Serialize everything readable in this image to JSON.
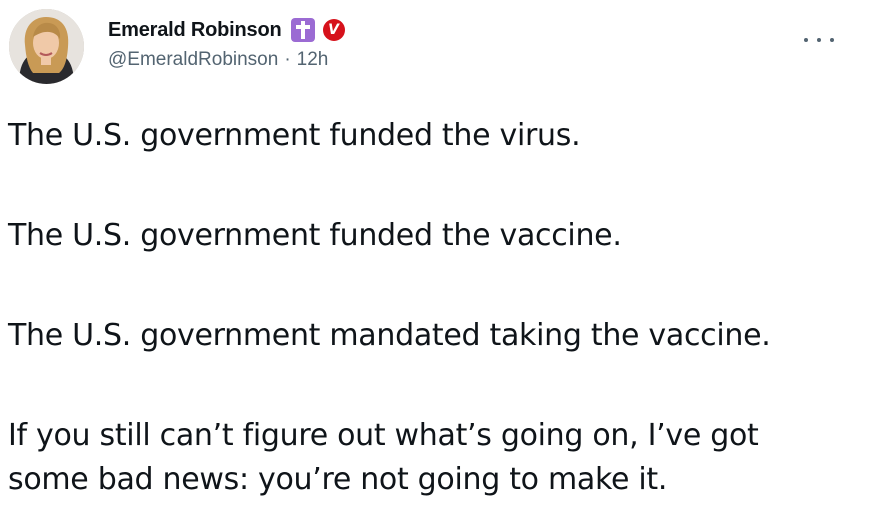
{
  "tweet": {
    "author": {
      "display_name": "Emerald Robinson",
      "handle": "@EmeraldRobinson",
      "badges": [
        "cross-badge",
        "verified-v-badge"
      ],
      "v_badge_letter": "V"
    },
    "time_separator": "·",
    "timestamp": "12h",
    "more_menu_icon": "ellipsis-icon",
    "paragraphs": [
      "The U.S. government funded the virus.",
      "The U.S. government funded the vaccine.",
      "The U.S. government mandated taking the vaccine.",
      "If you still can’t figure out what’s going on, I’ve got",
      "some bad news:  you’re not going to make it."
    ]
  },
  "colors": {
    "text": "#0f1419",
    "secondary_text": "#536471",
    "cross_badge": "#9b6bd3",
    "v_badge": "#d6111b"
  }
}
